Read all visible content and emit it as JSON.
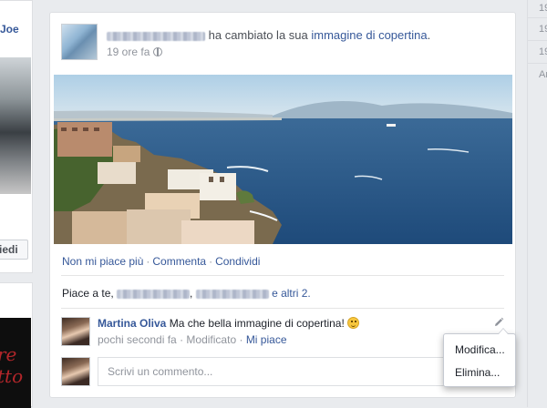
{
  "left_column": {
    "friend_name": "Joe",
    "button_label": "iedi"
  },
  "post": {
    "action_text": "ha cambiato la sua",
    "action_target": "immagine di copertina",
    "action_end": ".",
    "time": "19 ore fa",
    "privacy_icon": "globe-icon"
  },
  "actions": {
    "unlike": "Non mi piace più",
    "comment": "Commenta",
    "share": "Condividi",
    "separator": "·"
  },
  "likes": {
    "prefix": "Piace a te,",
    "comma": ",",
    "suffix": "e altri 2."
  },
  "comment": {
    "author": "Martina Oliva",
    "text": "Ma che bella immagine di copertina!",
    "emoji_icon": "smiley-icon",
    "time": "pochi secondi fa",
    "edited": "Modificato",
    "like": "Mi piace",
    "edit_icon": "pencil-icon"
  },
  "composer": {
    "placeholder": "Scrivi un commento..."
  },
  "menu": {
    "edit": "Modifica...",
    "delete": "Elimina..."
  },
  "right_column": {
    "lines": [
      "19",
      "19",
      "19",
      "Ar"
    ]
  },
  "colors": {
    "link": "#365899",
    "page_bg": "#e9ebee",
    "meta": "#90949c"
  }
}
